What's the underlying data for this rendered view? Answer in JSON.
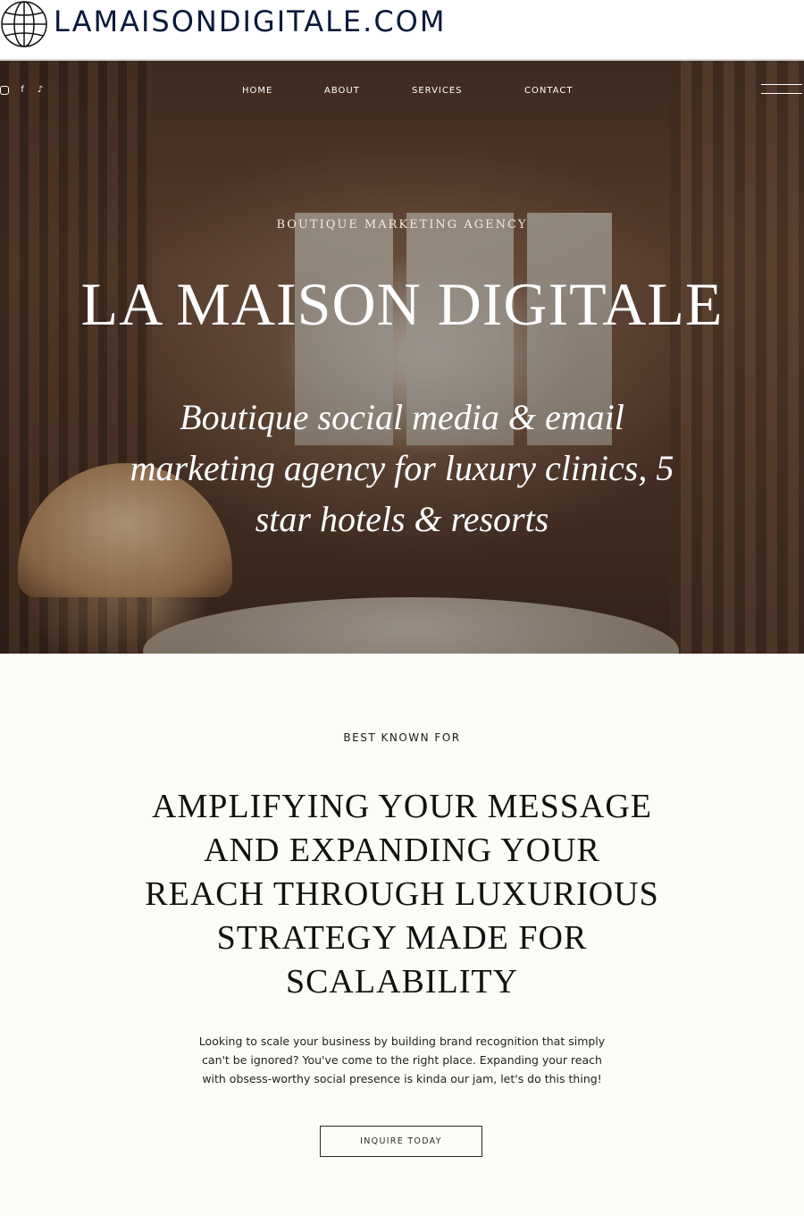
{
  "url_bar": {
    "icon": "globe-icon",
    "url": "LAMAISONDIGITALE.COM"
  },
  "social_icons": [
    "instagram-icon",
    "facebook-icon",
    "tiktok-icon"
  ],
  "nav": {
    "items": [
      {
        "label": "HOME"
      },
      {
        "label": "ABOUT"
      },
      {
        "label": "SERVICES"
      },
      {
        "label": "CONTACT"
      }
    ],
    "menu_icon": "hamburger-menu-icon"
  },
  "hero": {
    "kicker": "BOUTIQUE MARKETING AGENCY",
    "title": "LA MAISON DIGITALE",
    "subtitle": "Boutique social media & email marketing agency for luxury clinics, 5 star hotels & resorts"
  },
  "section": {
    "label": "BEST KNOWN FOR",
    "headline": "AMPLIFYING YOUR MESSAGE AND EXPANDING YOUR REACH THROUGH LUXURIOUS STRATEGY MADE FOR SCALABILITY",
    "body": "Looking to scale your business by building brand recognition that simply can't be ignored? You've come to the right place. Expanding your reach with obsess-worthy social presence is kinda our jam, let's do this thing!",
    "cta_label": "INQUIRE TODAY"
  },
  "colors": {
    "url_text": "#0b1a3a",
    "page_background": "#fcfbf7",
    "hero_text": "#ffffff",
    "dark_text": "#111111"
  }
}
